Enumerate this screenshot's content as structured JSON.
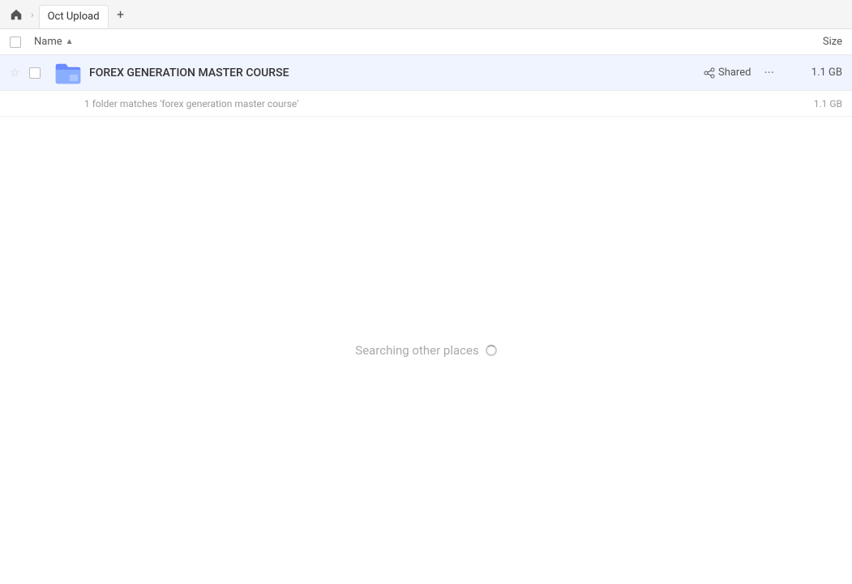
{
  "topbar": {
    "home_icon": "🏠",
    "tab_label": "Oct Upload",
    "add_icon": "+"
  },
  "columns": {
    "name_label": "Name",
    "sort_arrow": "▲",
    "size_label": "Size"
  },
  "file": {
    "name": "FOREX GENERATION MASTER COURSE",
    "shared_label": "Shared",
    "size": "1.1 GB",
    "more_icon": "···"
  },
  "match_info": {
    "text": "1 folder matches 'forex generation master course'",
    "size": "1.1 GB"
  },
  "searching": {
    "text": "Searching other places"
  }
}
